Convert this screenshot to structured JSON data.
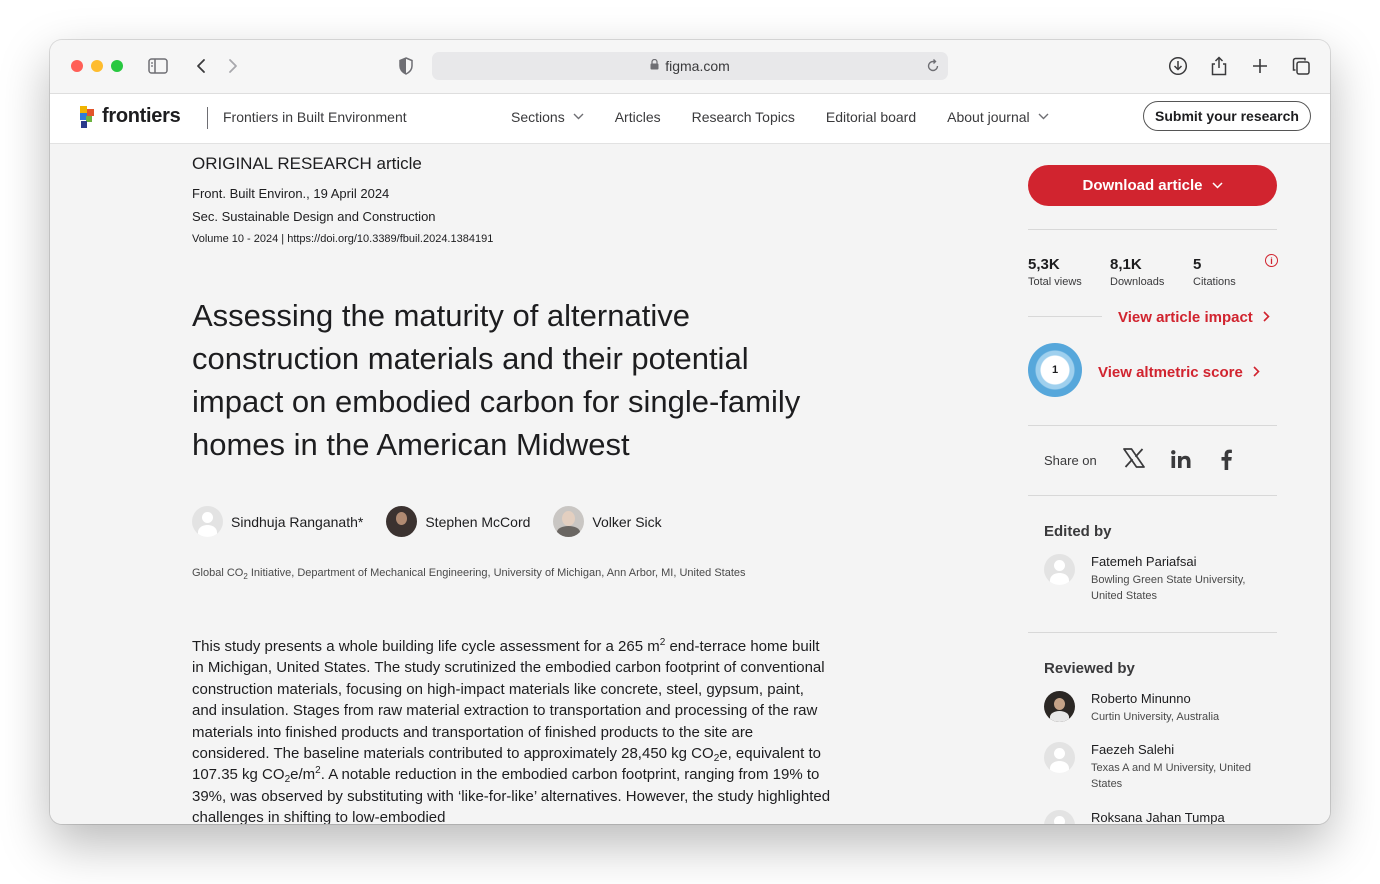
{
  "browser": {
    "url": "figma.com"
  },
  "header": {
    "logo_text": "frontiers",
    "journal_name": "Frontiers in Built Environment",
    "nav": [
      {
        "label": "Sections",
        "dropdown": true
      },
      {
        "label": "Articles",
        "dropdown": false
      },
      {
        "label": "Research Topics",
        "dropdown": false
      },
      {
        "label": "Editorial board",
        "dropdown": false
      },
      {
        "label": "About journal",
        "dropdown": true
      }
    ],
    "submit_label": "Submit your research"
  },
  "article": {
    "type": "ORIGINAL RESEARCH article",
    "journal_date": "Front. Built Environ., 19 April 2024",
    "section": "Sec. Sustainable Design and Construction",
    "volume": "Volume 10 - 2024 | ",
    "doi": "https://doi.org/10.3389/fbuil.2024.1384191",
    "title": "Assessing the maturity of alternative construction materials and their potential impact on embodied carbon for single-family homes in the American Midwest",
    "authors": [
      {
        "name": "Sindhuja Ranganath*",
        "avatar": "placeholder"
      },
      {
        "name": "Stephen McCord",
        "avatar": "photo"
      },
      {
        "name": "Volker Sick",
        "avatar": "photo"
      }
    ],
    "affiliation_pre": "Global CO",
    "affiliation_sub": "2",
    "affiliation_post": " Initiative, Department of Mechanical Engineering, University of Michigan, Ann Arbor, MI, United States",
    "abstract": {
      "p1": "This study presents a whole building life cycle assessment for a 265 m",
      "sup1": "2",
      "p2": " end-terrace home built in Michigan, United States. The study scrutinized the embodied carbon footprint of conventional construction materials, focusing on high-impact materials like concrete, steel, gypsum, paint, and insulation. Stages from raw material extraction to transportation and processing of the raw materials into finished products and transportation of finished products to the site are considered. The baseline materials contributed to approximately 28,450 kg CO",
      "sub1": "2",
      "p3": "e, equivalent to 107.35 kg CO",
      "sub2": "2",
      "p4": "e/m",
      "sup2": "2",
      "p5": ". A notable reduction in the embodied carbon footprint, ranging from 19% to 39%, was observed by substituting with ‘like-for-like’ alternatives. However, the study highlighted challenges in shifting to low-embodied"
    }
  },
  "sidebar": {
    "download_label": "Download article",
    "stats": [
      {
        "value": "5,3K",
        "label": "Total views"
      },
      {
        "value": "8,1K",
        "label": "Downloads"
      },
      {
        "value": "5",
        "label": "Citations"
      }
    ],
    "info_glyph": "i",
    "impact_link": "View article impact",
    "altmetric_score": "1",
    "altmetric_link": "View altmetric score",
    "share_label": "Share on",
    "share_icons": [
      "x-icon",
      "linkedin-icon",
      "facebook-icon"
    ],
    "edited_by_label": "Edited by",
    "editors": [
      {
        "name": "Fatemeh Pariafsai",
        "affiliation": "Bowling Green State University, United States"
      }
    ],
    "reviewed_by_label": "Reviewed by",
    "reviewers": [
      {
        "name": "Roberto Minunno",
        "affiliation": "Curtin University, Australia"
      },
      {
        "name": "Faezeh Salehi",
        "affiliation": "Texas A and M University, United States"
      },
      {
        "name": "Roksana Jahan Tumpa",
        "affiliation": ""
      }
    ],
    "accent_color": "#d1242f"
  }
}
